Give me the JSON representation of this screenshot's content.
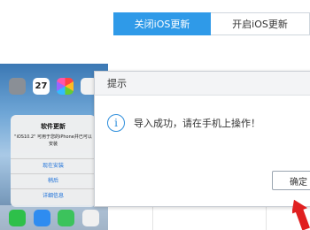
{
  "toggle": {
    "close_label": "关闭iOS更新",
    "open_label": "开启iOS更新"
  },
  "phone": {
    "calendar_day": "27",
    "alert": {
      "title": "软件更新",
      "message": "\"iOS10.2\" 可用于您的iPhone并已可以安装",
      "buttons": [
        "现在安装",
        "稍后",
        "详细信息"
      ]
    }
  },
  "dialog": {
    "title": "提示",
    "message": "导入成功，请在手机上操作！",
    "ok_label": "确定",
    "icon": "info-icon"
  },
  "colors": {
    "accent": "#2f9ae8",
    "arrow": "#e02020"
  }
}
